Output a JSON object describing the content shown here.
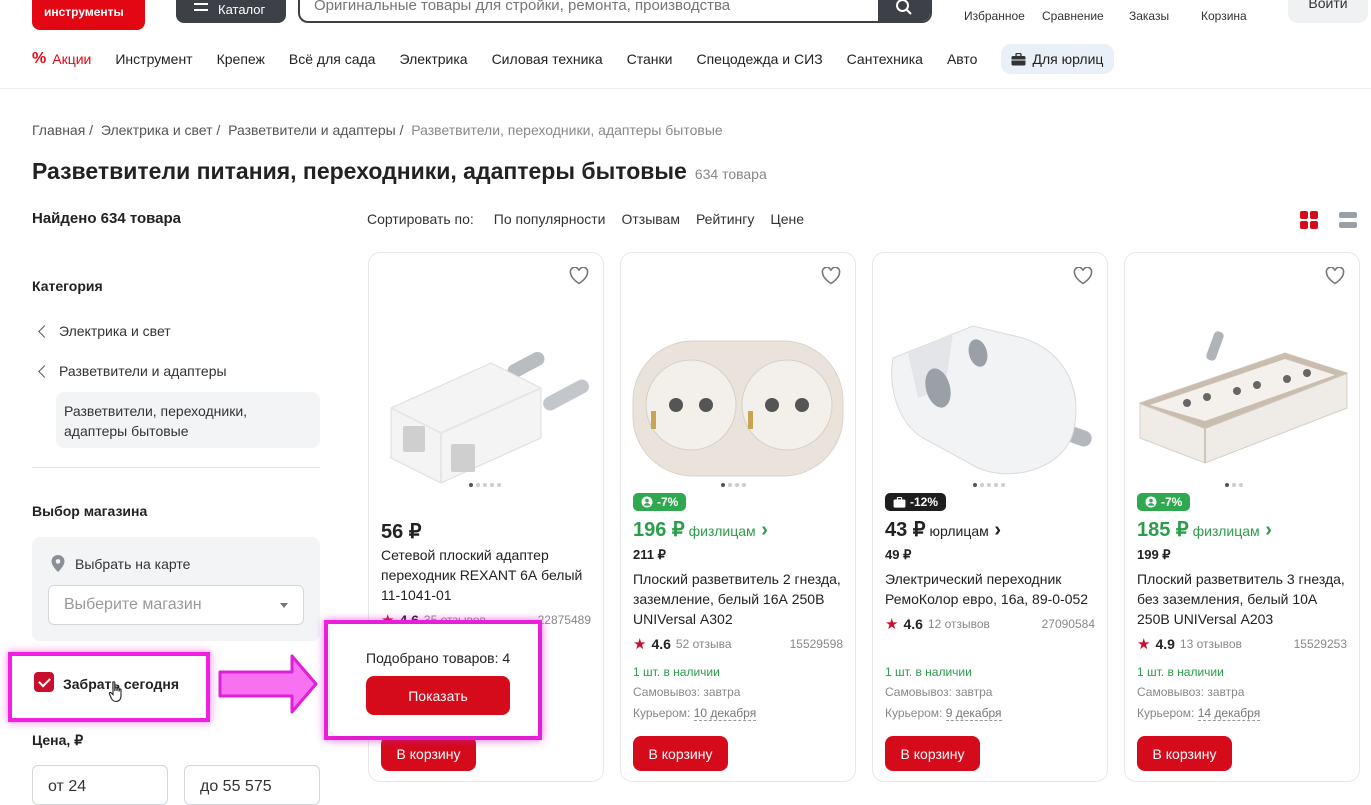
{
  "header": {
    "logo_text": "инструменты",
    "catalog_label": "Каталог",
    "search_placeholder": "Оригинальные товары для стройки, ремонта, производства",
    "links": [
      "Избранное",
      "Сравнение",
      "Заказы",
      "Корзина"
    ],
    "login_label": "Войти"
  },
  "nav": {
    "promo": "Акции",
    "items": [
      "Инструмент",
      "Крепеж",
      "Всё для сада",
      "Электрика",
      "Силовая техника",
      "Станки",
      "Спецодежда и СИЗ",
      "Сантехника",
      "Авто"
    ],
    "business": "Для юрлиц"
  },
  "breadcrumbs": [
    "Главная /",
    "Электрика и свет /",
    "Разветвители и адаптеры /",
    "Разветвители, переходники, адаптеры бытовые"
  ],
  "page": {
    "title": "Разветвители питания, переходники, адаптеры бытовые",
    "count": "634 товара",
    "found": "Найдено 634 товара"
  },
  "sort": {
    "label": "Сортировать по:",
    "options": [
      "По популярности",
      "Отзывам",
      "Рейтингу",
      "Цене"
    ]
  },
  "sidebar": {
    "category_heading": "Категория",
    "cat1": "Электрика и свет",
    "cat2": "Разветвители и адаптеры",
    "cat_current": "Разветвители, переходники, адаптеры бытовые",
    "store_heading": "Выбор магазина",
    "map_link": "Выбрать на карте",
    "store_placeholder": "Выберите магазин",
    "pickup_today": "Забрать сегодня",
    "pickup_checked": true,
    "price_heading": "Цена, ₽",
    "price_from": "от 24",
    "price_to": "до 55 575"
  },
  "popup": {
    "text": "Подобрано товаров: 4",
    "button": "Показать"
  },
  "cards": [
    {
      "price": "56 ₽",
      "name": "Сетевой плоский адаптер переходник REXANT 6А белый 11-1041-01",
      "rating": "4.6",
      "reviews": "35 отзывов",
      "sku": "22875489",
      "cart": "В корзину"
    },
    {
      "badge": "-7%",
      "price": "196 ₽",
      "who": "физлицам",
      "old": "211 ₽",
      "name": "Плоский разветвитель 2 гнезда, заземление, белый 16А 250В UNIVersal А302",
      "rating": "4.6",
      "reviews": "52 отзыва",
      "sku": "15529598",
      "stock": "1 шт. в наличии",
      "pickup": "Самовывоз: завтра",
      "courier_label": "Курьером:",
      "courier_date": "10 декабря",
      "cart": "В корзину"
    },
    {
      "badge": "-12%",
      "price": "43 ₽",
      "who": "юрлицам",
      "old": "49 ₽",
      "name": "Электрический переходник РемоКолор евро, 16а, 89-0-052",
      "rating": "4.6",
      "reviews": "12 отзывов",
      "sku": "27090584",
      "stock": "1 шт. в наличии",
      "pickup": "Самовывоз: завтра",
      "courier_label": "Курьером:",
      "courier_date": "9 декабря",
      "cart": "В корзину"
    },
    {
      "badge": "-7%",
      "price": "185 ₽",
      "who": "физлицам",
      "old": "199 ₽",
      "name": "Плоский разветвитель 3 гнезда, без заземления, белый 10А 250В UNIVersal А203",
      "rating": "4.9",
      "reviews": "13 отзывов",
      "sku": "15529253",
      "stock": "1 шт. в наличии",
      "pickup": "Самовывоз: завтра",
      "courier_label": "Курьером:",
      "courier_date": "14 декабря",
      "cart": "В корзину"
    }
  ],
  "colors": {
    "brand_red": "#e30613",
    "button_red": "#d50b1b",
    "green": "#2a9d4a",
    "highlight_magenta": "#f020e0"
  }
}
